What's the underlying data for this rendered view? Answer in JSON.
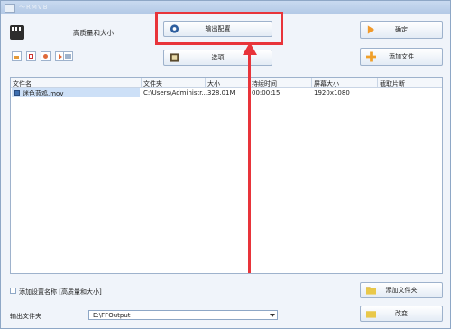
{
  "window": {
    "title": "～RMVB"
  },
  "profile": {
    "label": "高质量和大小"
  },
  "buttons": {
    "output_config": "输出配置",
    "options": "选项",
    "ok": "确定",
    "add_file": "添加文件",
    "add_folder": "添加文件夹",
    "change": "改变"
  },
  "list": {
    "columns": [
      "文件名",
      "文件夹",
      "大小",
      "持续时间",
      "屏幕大小",
      "截取片断"
    ],
    "rows": [
      {
        "name": "迷色蓝鸡.mov",
        "folder": "C:\\Users\\Administr...",
        "size": "328.01M",
        "duration": "00:00:15",
        "screen": "1920x1080",
        "clip": ""
      }
    ]
  },
  "footer": {
    "add_setting_label": "添加设置名称 [高质量和大小]",
    "output_folder_label": "输出文件夹",
    "output_folder_value": "E:\\FFOutput"
  },
  "colors": {
    "accent_red": "#e8343a",
    "orange_arrow": "#f19a2b",
    "plus_orange": "#f0a02a"
  }
}
